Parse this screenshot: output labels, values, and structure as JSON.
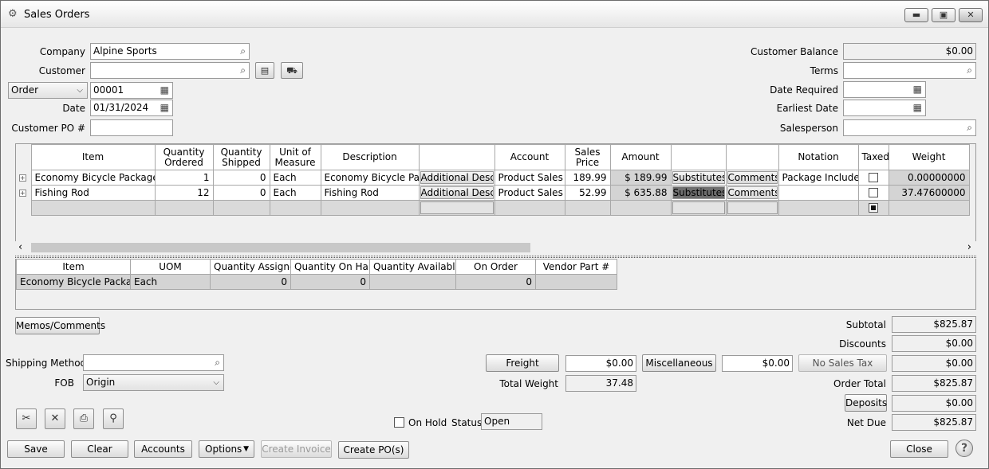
{
  "window": {
    "title": "Sales Orders",
    "min_glyph": "▬",
    "max_glyph": "▣",
    "close_glyph": "✕",
    "app_icon": "gear-icon"
  },
  "header": {
    "company_label": "Company",
    "company_value": "Alpine Sports",
    "customer_label": "Customer",
    "customer_value": "",
    "doc_type_value": "Order",
    "doc_number_value": "00001",
    "date_label": "Date",
    "date_value": "01/31/2024",
    "customer_po_label": "Customer PO #",
    "customer_po_value": "",
    "customer_balance_label": "Customer Balance",
    "customer_balance_value": "$0.00",
    "terms_label": "Terms",
    "terms_value": "",
    "date_required_label": "Date Required",
    "date_required_value": "",
    "earliest_date_label": "Earliest Date",
    "earliest_date_value": "",
    "salesperson_label": "Salesperson",
    "salesperson_value": ""
  },
  "grid": {
    "columns": [
      "Item",
      "Quantity Ordered",
      "Quantity Shipped",
      "Unit of Measure",
      "Description",
      "",
      "Account",
      "Sales Price",
      "Amount",
      "",
      "",
      "Notation",
      "Taxed",
      "Weight"
    ],
    "rows": [
      {
        "item": "Economy Bicycle Package",
        "qty_ordered": "1",
        "qty_shipped": "0",
        "uom": "Each",
        "description": "Economy Bicycle Pac",
        "add_desc": "Additional Descri",
        "account": "Product Sales",
        "price": "189.99",
        "amount": "$ 189.99",
        "substitutes": "Substitutes",
        "comments": "Comments",
        "notation": "Package Includes",
        "taxed": false,
        "weight": "0.00000000"
      },
      {
        "item": "Fishing Rod",
        "qty_ordered": "12",
        "qty_shipped": "0",
        "uom": "Each",
        "description": "Fishing Rod",
        "add_desc": "Additional Descri",
        "account": "Product Sales",
        "price": "52.99",
        "amount": "$ 635.88",
        "substitutes": "Substitutes",
        "comments": "Comments",
        "notation": "",
        "taxed": false,
        "weight": "37.47600000"
      }
    ],
    "scroll_left": "‹",
    "scroll_right": "›"
  },
  "subgrid": {
    "columns": [
      "Item",
      "UOM",
      "Quantity Assigned",
      "Quantity On Hand",
      "Quantity Available",
      "On Order",
      "Vendor Part #"
    ],
    "rows": [
      {
        "item": "Economy Bicycle Package",
        "uom": "Each",
        "assigned": "0",
        "on_hand": "0",
        "available": "",
        "on_order": "0",
        "vendor_part": ""
      }
    ]
  },
  "footer": {
    "memos_label": "Memos/Comments",
    "shipping_method_label": "Shipping Method",
    "shipping_method_value": "",
    "fob_label": "FOB",
    "fob_value": "Origin",
    "freight_label": "Freight",
    "freight_value": "$0.00",
    "misc_label": "Miscellaneous",
    "misc_value": "$0.00",
    "no_sales_tax_label": "No Sales Tax",
    "total_weight_label": "Total Weight",
    "total_weight_value": "37.48",
    "on_hold_label": "On Hold",
    "status_label": "Status",
    "status_value": "Open",
    "subtotal_label": "Subtotal",
    "subtotal_value": "$825.87",
    "discounts_label": "Discounts",
    "discounts_value": "$0.00",
    "tax_value": "$0.00",
    "order_total_label": "Order Total",
    "order_total_value": "$825.87",
    "deposits_label": "Deposits",
    "deposits_value": "$0.00",
    "net_due_label": "Net Due",
    "net_due_value": "$825.87"
  },
  "actions": {
    "save": "Save",
    "clear": "Clear",
    "accounts": "Accounts",
    "options": "Options",
    "create_invoice": "Create Invoice",
    "create_pos": "Create PO(s)",
    "close": "Close",
    "help": "?"
  }
}
